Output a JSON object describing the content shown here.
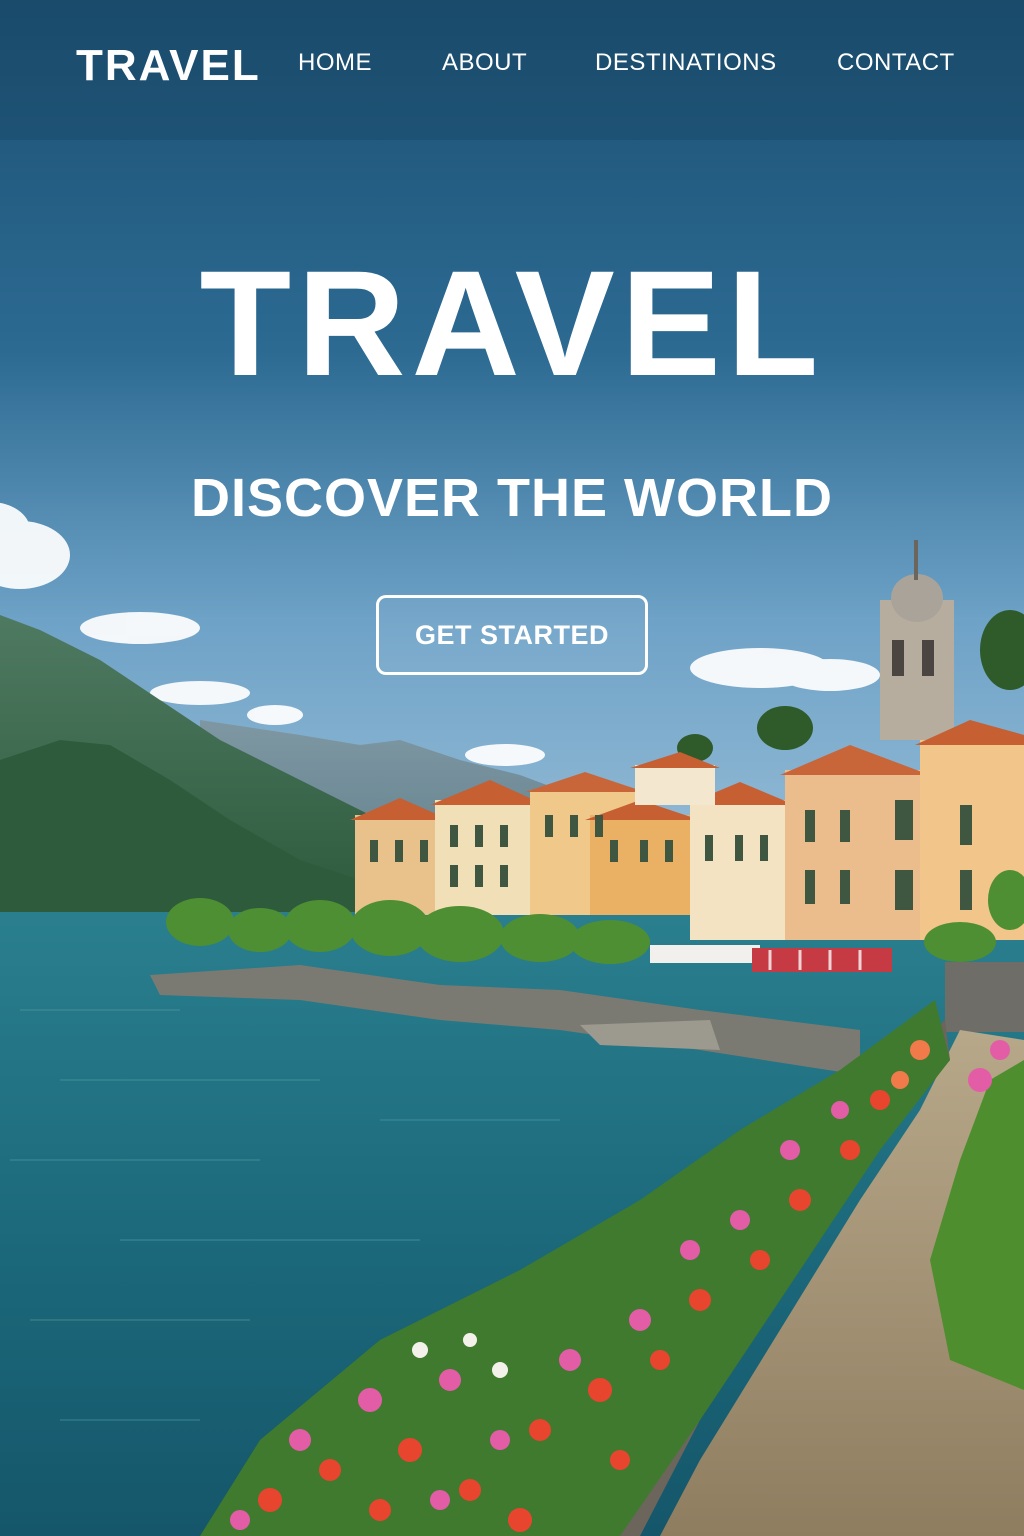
{
  "nav": {
    "logo": "TRAVEL",
    "links": [
      {
        "label": "HOME"
      },
      {
        "label": "ABOUT"
      },
      {
        "label": "DESTINATIONS"
      },
      {
        "label": "CONTACT"
      }
    ]
  },
  "hero": {
    "title": "TRAVEL",
    "subtitle": "DISCOVER THE WORLD",
    "cta_label": "GET STARTED"
  },
  "colors": {
    "sky_top": "#1d5578",
    "sky_bottom": "#5b97c2",
    "lake": "#1e6f80",
    "text": "#ffffff"
  }
}
